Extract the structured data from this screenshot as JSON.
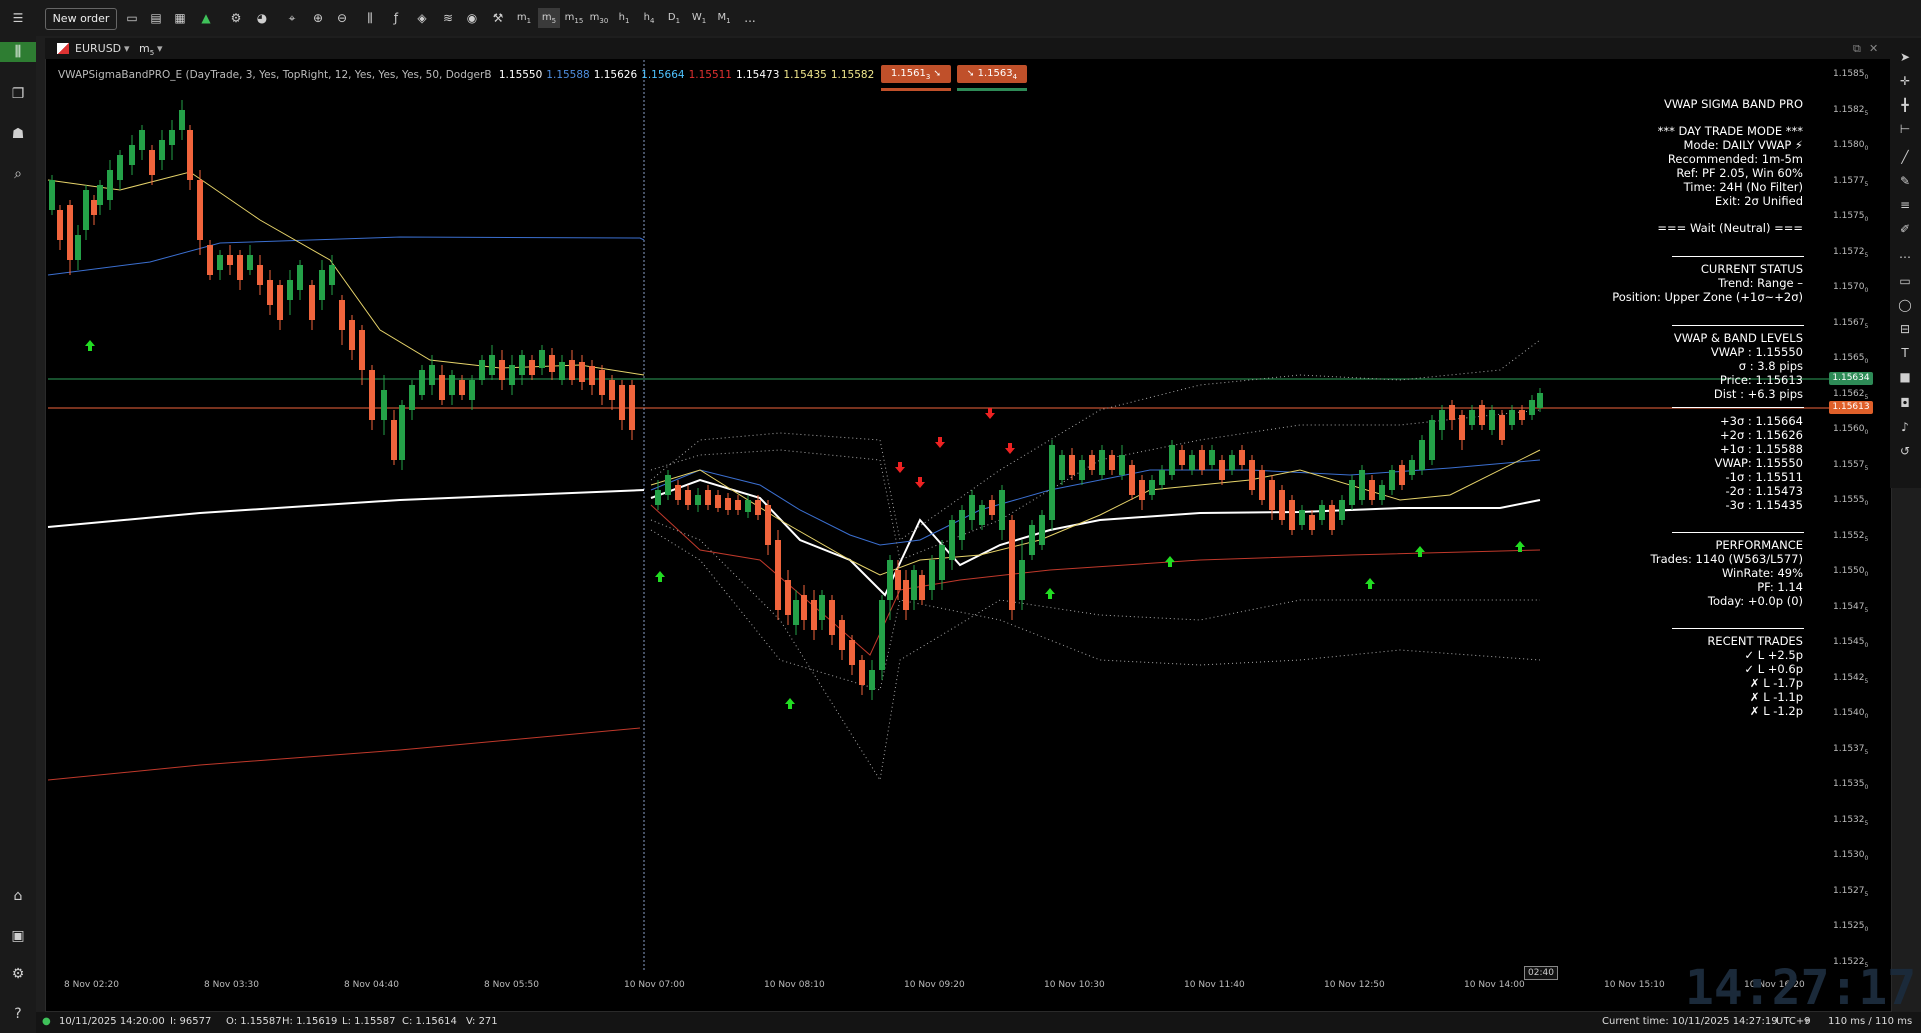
{
  "toolbar": {
    "new_order_label": "New order",
    "timeframes": [
      {
        "main": "m",
        "sub": "1"
      },
      {
        "main": "m",
        "sub": "5"
      },
      {
        "main": "m",
        "sub": "15"
      },
      {
        "main": "m",
        "sub": "30"
      },
      {
        "main": "h",
        "sub": "1"
      },
      {
        "main": "h",
        "sub": "4"
      },
      {
        "main": "D",
        "sub": "1"
      },
      {
        "main": "W",
        "sub": "1"
      },
      {
        "main": "M",
        "sub": "1"
      }
    ],
    "more": "..."
  },
  "chart_tab": {
    "symbol": "EURUSD",
    "timeframe": "m",
    "timeframe_sub": "5"
  },
  "indicator_line": {
    "name": "VWAPSigmaBandPRO_E (DayTrade, 3, Yes, TopRight, 12, Yes, Yes, Yes, 50, DodgerB",
    "values": [
      {
        "text": "1.15550",
        "color": "#ffffff"
      },
      {
        "text": "1.15588",
        "color": "#4f8fe0"
      },
      {
        "text": "1.15626",
        "color": "#ffffff"
      },
      {
        "text": "1.15664",
        "color": "#4fc3ff"
      },
      {
        "text": "1.15511",
        "color": "#e03030"
      },
      {
        "text": "1.15473",
        "color": "#ffffff"
      },
      {
        "text": "1.15435",
        "color": "#f0e68c"
      },
      {
        "text": "1.15582",
        "color": "#f0e68c"
      }
    ]
  },
  "quote_boxes": {
    "sell": "1.1561",
    "sell_sub": "3",
    "buy": "1.1563",
    "buy_sub": "4"
  },
  "info_panel": {
    "title": "VWAP SIGMA BAND PRO",
    "mode_header": "*** DAY TRADE MODE ***",
    "mode": "Mode: DAILY VWAP ⚡",
    "recommended": "Recommended: 1m-5m",
    "ref": "Ref: PF 2.05, Win 60%",
    "time": "Time: 24H (No Filter)",
    "exit": "Exit: 2σ Unified",
    "signal": "=== Wait (Neutral) ===",
    "status_header": "CURRENT STATUS",
    "trend": "Trend: Range –",
    "position": "Position: Upper Zone (+1σ~+2σ)",
    "levels_header": "VWAP & BAND LEVELS",
    "vwap": "VWAP : 1.15550",
    "sigma": "σ    : 3.8 pips",
    "price": "Price: 1.15613",
    "dist": "Dist : +6.3 pips",
    "bands": [
      "+3σ : 1.15664",
      "+2σ : 1.15626",
      "+1σ : 1.15588",
      "VWAP: 1.15550",
      "-1σ : 1.15511",
      "-2σ : 1.15473",
      "-3σ : 1.15435"
    ],
    "perf_header": "PERFORMANCE",
    "trades": "Trades: 1140 (W563/L577)",
    "winrate": "WinRate: 49%",
    "pf": "PF: 1.14",
    "today": "Today: +0.0p (0)",
    "recent_header": "RECENT TRADES",
    "recent": [
      "✓ L +2.5p",
      "✓ L +0.6p",
      "✗ L -1.7p",
      "✗ L -1.1p",
      "✗ L -1.2p"
    ]
  },
  "price_axis": [
    {
      "main": "1.1585",
      "sub": "0"
    },
    {
      "main": "1.1582",
      "sub": "5"
    },
    {
      "main": "1.1580",
      "sub": "0"
    },
    {
      "main": "1.1577",
      "sub": "5"
    },
    {
      "main": "1.1575",
      "sub": "0"
    },
    {
      "main": "1.1572",
      "sub": "5"
    },
    {
      "main": "1.1570",
      "sub": "0"
    },
    {
      "main": "1.1567",
      "sub": "5"
    },
    {
      "main": "1.1565",
      "sub": "0"
    },
    {
      "main": "1.1562",
      "sub": "5"
    },
    {
      "main": "1.1560",
      "sub": "0"
    },
    {
      "main": "1.1557",
      "sub": "5"
    },
    {
      "main": "1.1555",
      "sub": "0"
    },
    {
      "main": "1.1552",
      "sub": "5"
    },
    {
      "main": "1.1550",
      "sub": "0"
    },
    {
      "main": "1.1547",
      "sub": "5"
    },
    {
      "main": "1.1545",
      "sub": "0"
    },
    {
      "main": "1.1542",
      "sub": "5"
    },
    {
      "main": "1.1540",
      "sub": "0"
    },
    {
      "main": "1.1537",
      "sub": "5"
    },
    {
      "main": "1.1535",
      "sub": "0"
    },
    {
      "main": "1.1532",
      "sub": "5"
    },
    {
      "main": "1.1530",
      "sub": "0"
    },
    {
      "main": "1.1527",
      "sub": "5"
    },
    {
      "main": "1.1525",
      "sub": "0"
    },
    {
      "main": "1.1522",
      "sub": "5"
    }
  ],
  "price_tags": {
    "ask": "1.15634",
    "bid": "1.15613"
  },
  "time_axis": [
    "8 Nov 02:20",
    "8 Nov 03:30",
    "8 Nov 04:40",
    "8 Nov 05:50",
    "10 Nov 07:00",
    "10 Nov 08:10",
    "10 Nov 09:20",
    "10 Nov 10:30",
    "10 Nov 11:40",
    "10 Nov 12:50",
    "10 Nov 14:00",
    "10 Nov 15:10",
    "10 Nov 16:20"
  ],
  "countdown": "02:40",
  "clock_watermark": "14:27:17",
  "status_bar": {
    "date": "10/11/2025 14:20:00",
    "index": "I: 96577",
    "open": "O: 1.15587",
    "high": "H: 1.15619",
    "low": "L: 1.15587",
    "close": "C: 1.15614",
    "volume": "V: 271",
    "current_time": "Current time:  10/11/2025 14:27:19",
    "timezone": "UTC+9",
    "latency": "110 ms / 110 ms"
  },
  "colors": {
    "bull": "#24a148",
    "bear": "#f0643c",
    "vwap": "#ffffff",
    "blue_line": "#3b6fd0",
    "yellow_line": "#e6d36a",
    "red_line": "#c0392b",
    "ask_line": "#2ea05a",
    "bid_line": "#f0643c"
  }
}
